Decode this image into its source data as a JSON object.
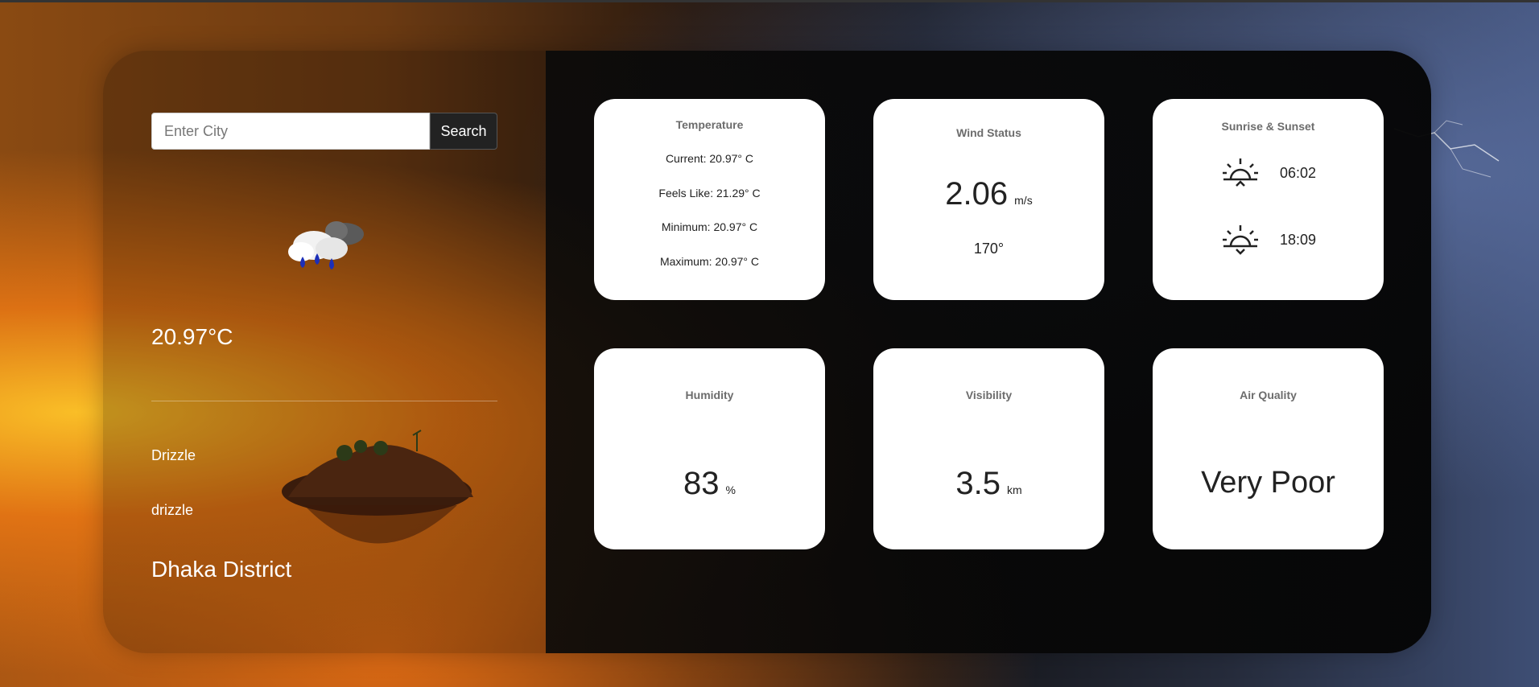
{
  "search": {
    "placeholder": "Enter City",
    "button_label": "Search"
  },
  "current": {
    "icon": "rain-cloud-icon",
    "temperature": "20.97°C",
    "condition_main": "Drizzle",
    "condition_desc": "drizzle",
    "location": "Dhaka District"
  },
  "cards": {
    "temperature": {
      "title": "Temperature",
      "current": "Current: 20.97° C",
      "feels_like": "Feels Like: 21.29° C",
      "minimum": "Minimum: 20.97° C",
      "maximum": "Maximum: 20.97° C"
    },
    "wind": {
      "title": "Wind Status",
      "speed": "2.06",
      "speed_unit": "m/s",
      "direction": "170°"
    },
    "sun": {
      "title": "Sunrise & Sunset",
      "sunrise_icon": "sunrise-icon",
      "sunrise": "06:02",
      "sunset_icon": "sunset-icon",
      "sunset": "18:09"
    },
    "humidity": {
      "title": "Humidity",
      "value": "83",
      "unit": "%"
    },
    "visibility": {
      "title": "Visibility",
      "value": "3.5",
      "unit": "km"
    },
    "air_quality": {
      "title": "Air Quality",
      "value": "Very Poor"
    }
  }
}
